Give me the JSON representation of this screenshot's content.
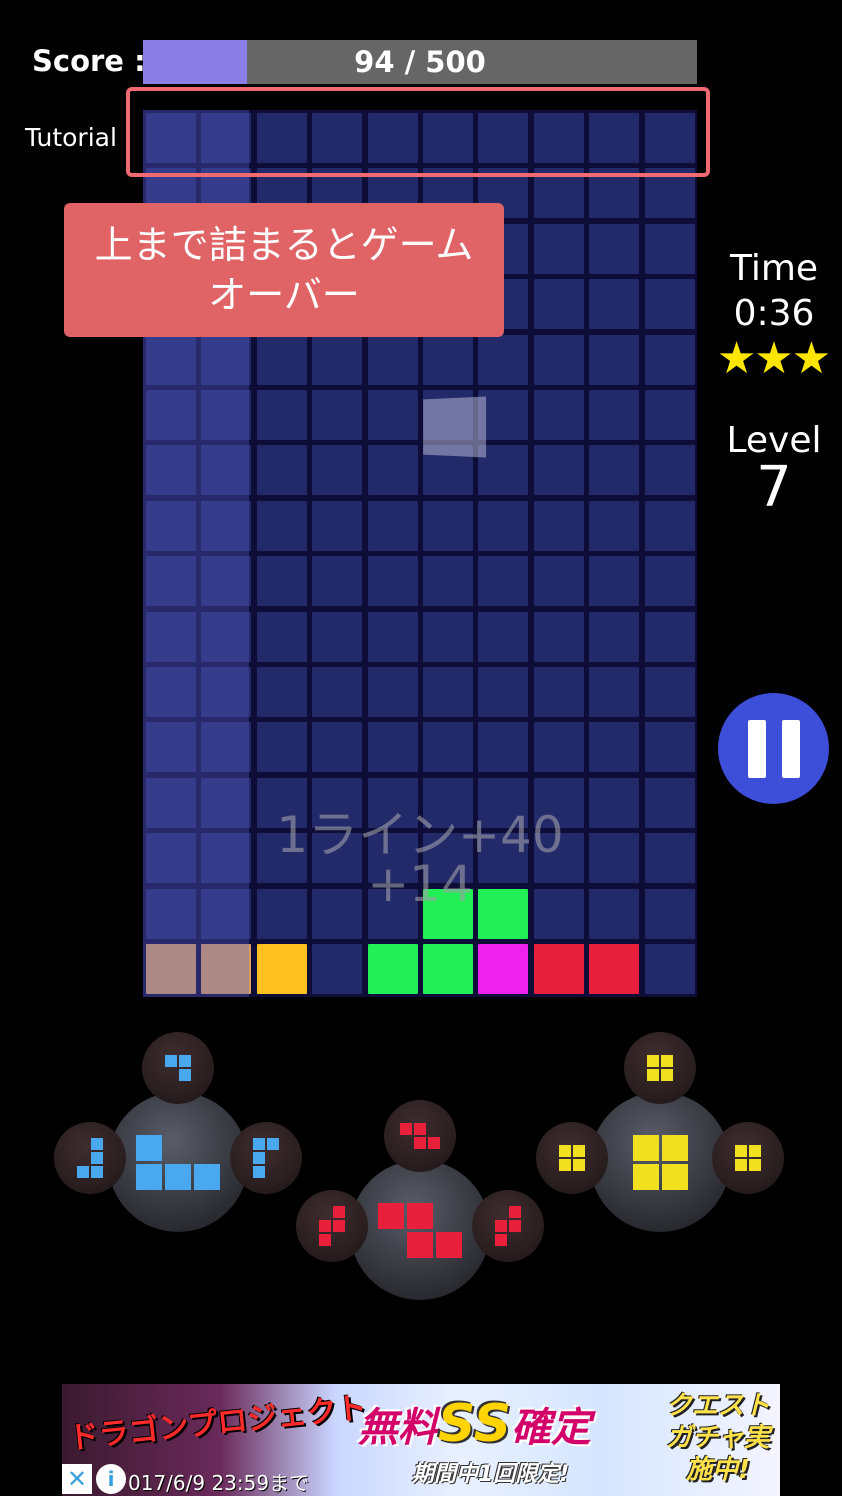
{
  "score": {
    "label": "Score :",
    "current": 94,
    "max": 500,
    "text": "94 / 500",
    "fill_fraction": 0.188,
    "fill_color": "#8b7fe6"
  },
  "tutorial": {
    "label": "Tutorial",
    "message": "上まで詰まるとゲームオーバー",
    "frame_color": "#f06a72",
    "box_color": "#e06366"
  },
  "board": {
    "cols": 10,
    "rows": 16,
    "empty_color": "#232a6a",
    "filled": [
      {
        "row": 14,
        "col": 5,
        "color": "#22ee55"
      },
      {
        "row": 14,
        "col": 6,
        "color": "#22ee55"
      },
      {
        "row": 15,
        "col": 0,
        "color": "#d9a060"
      },
      {
        "row": 15,
        "col": 1,
        "color": "#d9a060"
      },
      {
        "row": 15,
        "col": 2,
        "color": "#ffc020"
      },
      {
        "row": 15,
        "col": 4,
        "color": "#22ee55"
      },
      {
        "row": 15,
        "col": 5,
        "color": "#22ee55"
      },
      {
        "row": 15,
        "col": 6,
        "color": "#ee22ee"
      },
      {
        "row": 15,
        "col": 7,
        "color": "#e8203c"
      },
      {
        "row": 15,
        "col": 8,
        "color": "#e8203c"
      }
    ]
  },
  "floating": {
    "line_bonus": "1ライン+40",
    "bonus": "+14"
  },
  "hud": {
    "time_label": "Time",
    "time_value": "0:36",
    "stars": "★★★",
    "star_count": 3,
    "level_label": "Level",
    "level_value": "7"
  },
  "pause": {
    "icon": "pause-icon",
    "color": "#3d4ed9"
  },
  "pieces": [
    {
      "name": "blue-j",
      "color": "#4aa8ee"
    },
    {
      "name": "red-z",
      "color": "#e8203c"
    },
    {
      "name": "yellow-o",
      "color": "#f0e020"
    }
  ],
  "ad": {
    "logo": "ドラゴンプロジェクト",
    "main_prefix": "無料",
    "main_ss": "SS",
    "main_suffix": "確定",
    "sub": "期間中1回限定!",
    "right": "クエストガチャ実施中!",
    "date": "017/6/9 23:59まで",
    "close": "✕",
    "info": "i"
  }
}
